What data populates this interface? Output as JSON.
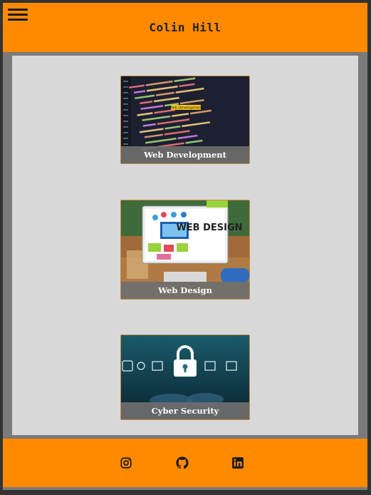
{
  "header": {
    "title": "Colin Hill",
    "menu_icon": "hamburger-menu-icon"
  },
  "cards": [
    {
      "label": "Web Development",
      "image": "code-editor-screenshot",
      "image_tag": "Web Development"
    },
    {
      "label": "Web Design",
      "image": "web-design-desk-illustration",
      "image_text": "WEB DESIGN"
    },
    {
      "label": "Cyber Security",
      "image": "padlock-security-illustration"
    }
  ],
  "footer": {
    "social": [
      {
        "name": "instagram",
        "icon": "instagram-icon"
      },
      {
        "name": "github",
        "icon": "github-icon"
      },
      {
        "name": "linkedin",
        "icon": "linkedin-icon"
      }
    ]
  },
  "colors": {
    "accent": "#ff8a00",
    "background": "#d8d8d8",
    "frame": "#7a7a7a",
    "caption_bg": "#6e6e6e"
  }
}
